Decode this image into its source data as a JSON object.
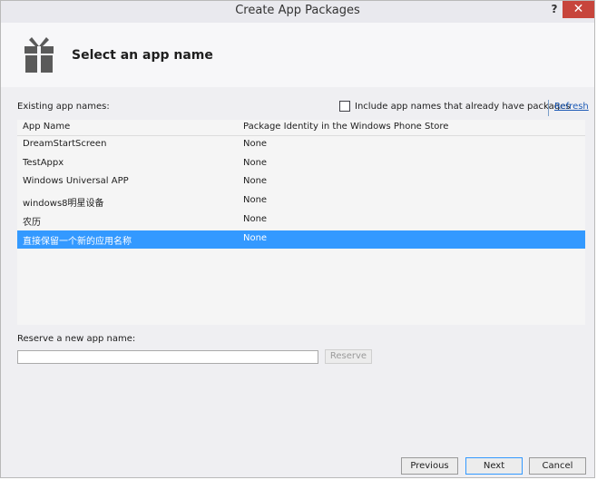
{
  "window": {
    "title": "Create App Packages",
    "help_glyph": "?",
    "close_glyph": "✕"
  },
  "header": {
    "title": "Select an app name",
    "icon": "gift-icon"
  },
  "existing": {
    "label": "Existing app names:",
    "include_label": "Include app names that already have packages",
    "include_checked": false,
    "refresh_label": "Refresh"
  },
  "table": {
    "columns": [
      "App Name",
      "Package Identity in the Windows Phone Store"
    ],
    "rows": [
      {
        "name": "DreamStartScreen",
        "identity": "None",
        "selected": false
      },
      {
        "name": "TestAppx",
        "identity": "None",
        "selected": false
      },
      {
        "name": "Windows Universal APP",
        "identity": "None",
        "selected": false
      },
      {
        "name": "windows8明星设备",
        "identity": "None",
        "selected": false
      },
      {
        "name": "农历",
        "identity": "None",
        "selected": false
      },
      {
        "name": "直接保留一个新的应用名称",
        "identity": "None",
        "selected": true
      }
    ]
  },
  "reserve": {
    "label": "Reserve a new app name:",
    "value": "",
    "button_label": "Reserve"
  },
  "footer": {
    "previous_label": "Previous",
    "next_label": "Next",
    "cancel_label": "Cancel"
  },
  "colors": {
    "selection": "#3399ff",
    "close": "#c7453c",
    "link": "#1e5bb6"
  }
}
